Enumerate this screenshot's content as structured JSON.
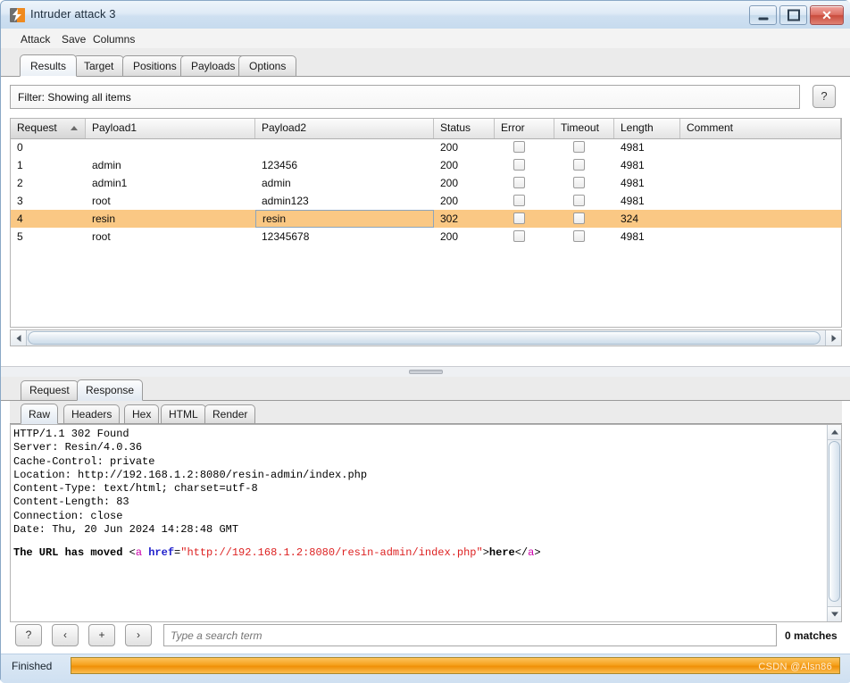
{
  "window": {
    "title": "Intruder attack 3",
    "app_icon": "burp-bolt-icon",
    "minimize_label": "–",
    "maximize_label": "□",
    "close_label": "✕"
  },
  "menubar": {
    "items": [
      {
        "label": "Attack"
      },
      {
        "label": "Save"
      },
      {
        "label": "Columns"
      }
    ]
  },
  "main_tabs": {
    "items": [
      {
        "label": "Results",
        "active": true
      },
      {
        "label": "Target",
        "active": false
      },
      {
        "label": "Positions",
        "active": false
      },
      {
        "label": "Payloads",
        "active": false
      },
      {
        "label": "Options",
        "active": false
      }
    ]
  },
  "filter": {
    "text": "Filter: Showing all items",
    "help_label": "?"
  },
  "results_table": {
    "columns": [
      {
        "label": "Request",
        "sorted": true,
        "sort_dir": "asc"
      },
      {
        "label": "Payload1"
      },
      {
        "label": "Payload2"
      },
      {
        "label": "Status"
      },
      {
        "label": "Error"
      },
      {
        "label": "Timeout"
      },
      {
        "label": "Length"
      },
      {
        "label": "Comment"
      }
    ],
    "rows": [
      {
        "request": "0",
        "payload1": "",
        "payload2": "",
        "status": "200",
        "error": false,
        "timeout": false,
        "length": "4981",
        "comment": "",
        "selected": false
      },
      {
        "request": "1",
        "payload1": "admin",
        "payload2": "123456",
        "status": "200",
        "error": false,
        "timeout": false,
        "length": "4981",
        "comment": "",
        "selected": false
      },
      {
        "request": "2",
        "payload1": "admin1",
        "payload2": "admin",
        "status": "200",
        "error": false,
        "timeout": false,
        "length": "4981",
        "comment": "",
        "selected": false
      },
      {
        "request": "3",
        "payload1": "root",
        "payload2": "admin123",
        "status": "200",
        "error": false,
        "timeout": false,
        "length": "4981",
        "comment": "",
        "selected": false
      },
      {
        "request": "4",
        "payload1": "resin",
        "payload2": "resin",
        "status": "302",
        "error": false,
        "timeout": false,
        "length": "324",
        "comment": "",
        "selected": true
      },
      {
        "request": "5",
        "payload1": "root",
        "payload2": "12345678",
        "status": "200",
        "error": false,
        "timeout": false,
        "length": "4981",
        "comment": "",
        "selected": false
      }
    ]
  },
  "message_tabs": {
    "items": [
      {
        "label": "Request",
        "active": false
      },
      {
        "label": "Response",
        "active": true
      }
    ]
  },
  "view_tabs": {
    "items": [
      {
        "label": "Raw",
        "active": true
      },
      {
        "label": "Headers",
        "active": false
      },
      {
        "label": "Hex",
        "active": false
      },
      {
        "label": "HTML",
        "active": false
      },
      {
        "label": "Render",
        "active": false
      }
    ]
  },
  "response": {
    "headers": "HTTP/1.1 302 Found\nServer: Resin/4.0.36\nCache-Control: private\nLocation: http://192.168.1.2:8080/resin-admin/index.php\nContent-Type: text/html; charset=utf-8\nContent-Length: 83\nConnection: close\nDate: Thu, 20 Jun 2024 14:28:48 GMT",
    "body_parts": {
      "text": "The URL has moved ",
      "open_bracket": "<",
      "tag": "a",
      "space": " ",
      "attr": "href",
      "equals": "=",
      "value": "\"http://192.168.1.2:8080/resin-admin/index.php\"",
      "close_bracket": ">",
      "link_text": "here",
      "end_tag_open": "</",
      "end_tag": "a",
      "end_bracket": ">"
    }
  },
  "search": {
    "help_label": "?",
    "prev_label": "‹",
    "plus_label": "+",
    "next_label": "›",
    "placeholder": "Type a search term",
    "value": "",
    "matches": "0 matches"
  },
  "statusbar": {
    "status": "Finished",
    "progress_percent": 100,
    "watermark": "CSDN @Alsn86"
  },
  "colors": {
    "selected_row": "#fac884",
    "progress_fill": "#f6a21e",
    "tag": "#cc00aa",
    "attr": "#2222cc",
    "value": "#dd2222"
  }
}
